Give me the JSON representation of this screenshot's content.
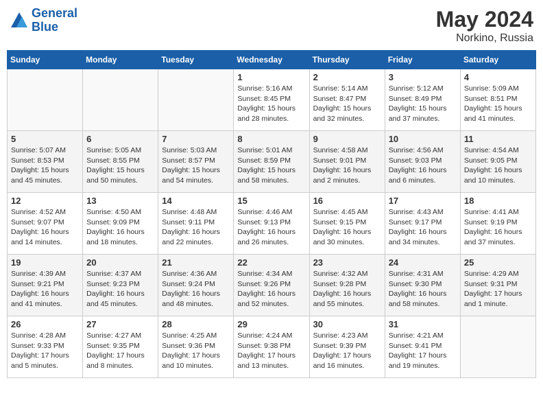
{
  "header": {
    "logo_line1": "General",
    "logo_line2": "Blue",
    "title": "May 2024",
    "subtitle": "Norkino, Russia"
  },
  "days_of_week": [
    "Sunday",
    "Monday",
    "Tuesday",
    "Wednesday",
    "Thursday",
    "Friday",
    "Saturday"
  ],
  "weeks": [
    [
      {
        "day": "",
        "info": ""
      },
      {
        "day": "",
        "info": ""
      },
      {
        "day": "",
        "info": ""
      },
      {
        "day": "1",
        "info": "Sunrise: 5:16 AM\nSunset: 8:45 PM\nDaylight: 15 hours\nand 28 minutes."
      },
      {
        "day": "2",
        "info": "Sunrise: 5:14 AM\nSunset: 8:47 PM\nDaylight: 15 hours\nand 32 minutes."
      },
      {
        "day": "3",
        "info": "Sunrise: 5:12 AM\nSunset: 8:49 PM\nDaylight: 15 hours\nand 37 minutes."
      },
      {
        "day": "4",
        "info": "Sunrise: 5:09 AM\nSunset: 8:51 PM\nDaylight: 15 hours\nand 41 minutes."
      }
    ],
    [
      {
        "day": "5",
        "info": "Sunrise: 5:07 AM\nSunset: 8:53 PM\nDaylight: 15 hours\nand 45 minutes."
      },
      {
        "day": "6",
        "info": "Sunrise: 5:05 AM\nSunset: 8:55 PM\nDaylight: 15 hours\nand 50 minutes."
      },
      {
        "day": "7",
        "info": "Sunrise: 5:03 AM\nSunset: 8:57 PM\nDaylight: 15 hours\nand 54 minutes."
      },
      {
        "day": "8",
        "info": "Sunrise: 5:01 AM\nSunset: 8:59 PM\nDaylight: 15 hours\nand 58 minutes."
      },
      {
        "day": "9",
        "info": "Sunrise: 4:58 AM\nSunset: 9:01 PM\nDaylight: 16 hours\nand 2 minutes."
      },
      {
        "day": "10",
        "info": "Sunrise: 4:56 AM\nSunset: 9:03 PM\nDaylight: 16 hours\nand 6 minutes."
      },
      {
        "day": "11",
        "info": "Sunrise: 4:54 AM\nSunset: 9:05 PM\nDaylight: 16 hours\nand 10 minutes."
      }
    ],
    [
      {
        "day": "12",
        "info": "Sunrise: 4:52 AM\nSunset: 9:07 PM\nDaylight: 16 hours\nand 14 minutes."
      },
      {
        "day": "13",
        "info": "Sunrise: 4:50 AM\nSunset: 9:09 PM\nDaylight: 16 hours\nand 18 minutes."
      },
      {
        "day": "14",
        "info": "Sunrise: 4:48 AM\nSunset: 9:11 PM\nDaylight: 16 hours\nand 22 minutes."
      },
      {
        "day": "15",
        "info": "Sunrise: 4:46 AM\nSunset: 9:13 PM\nDaylight: 16 hours\nand 26 minutes."
      },
      {
        "day": "16",
        "info": "Sunrise: 4:45 AM\nSunset: 9:15 PM\nDaylight: 16 hours\nand 30 minutes."
      },
      {
        "day": "17",
        "info": "Sunrise: 4:43 AM\nSunset: 9:17 PM\nDaylight: 16 hours\nand 34 minutes."
      },
      {
        "day": "18",
        "info": "Sunrise: 4:41 AM\nSunset: 9:19 PM\nDaylight: 16 hours\nand 37 minutes."
      }
    ],
    [
      {
        "day": "19",
        "info": "Sunrise: 4:39 AM\nSunset: 9:21 PM\nDaylight: 16 hours\nand 41 minutes."
      },
      {
        "day": "20",
        "info": "Sunrise: 4:37 AM\nSunset: 9:23 PM\nDaylight: 16 hours\nand 45 minutes."
      },
      {
        "day": "21",
        "info": "Sunrise: 4:36 AM\nSunset: 9:24 PM\nDaylight: 16 hours\nand 48 minutes."
      },
      {
        "day": "22",
        "info": "Sunrise: 4:34 AM\nSunset: 9:26 PM\nDaylight: 16 hours\nand 52 minutes."
      },
      {
        "day": "23",
        "info": "Sunrise: 4:32 AM\nSunset: 9:28 PM\nDaylight: 16 hours\nand 55 minutes."
      },
      {
        "day": "24",
        "info": "Sunrise: 4:31 AM\nSunset: 9:30 PM\nDaylight: 16 hours\nand 58 minutes."
      },
      {
        "day": "25",
        "info": "Sunrise: 4:29 AM\nSunset: 9:31 PM\nDaylight: 17 hours\nand 1 minute."
      }
    ],
    [
      {
        "day": "26",
        "info": "Sunrise: 4:28 AM\nSunset: 9:33 PM\nDaylight: 17 hours\nand 5 minutes."
      },
      {
        "day": "27",
        "info": "Sunrise: 4:27 AM\nSunset: 9:35 PM\nDaylight: 17 hours\nand 8 minutes."
      },
      {
        "day": "28",
        "info": "Sunrise: 4:25 AM\nSunset: 9:36 PM\nDaylight: 17 hours\nand 10 minutes."
      },
      {
        "day": "29",
        "info": "Sunrise: 4:24 AM\nSunset: 9:38 PM\nDaylight: 17 hours\nand 13 minutes."
      },
      {
        "day": "30",
        "info": "Sunrise: 4:23 AM\nSunset: 9:39 PM\nDaylight: 17 hours\nand 16 minutes."
      },
      {
        "day": "31",
        "info": "Sunrise: 4:21 AM\nSunset: 9:41 PM\nDaylight: 17 hours\nand 19 minutes."
      },
      {
        "day": "",
        "info": ""
      }
    ]
  ]
}
